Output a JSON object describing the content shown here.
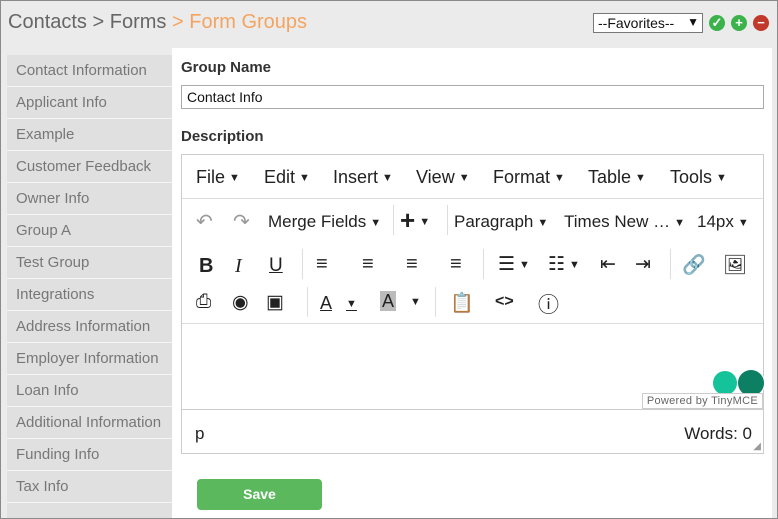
{
  "breadcrumb": {
    "contacts": "Contacts",
    "separator1": ">",
    "forms": "Forms",
    "separator2": ">",
    "current": "Form Groups"
  },
  "favorites": {
    "selected": "--Favorites--"
  },
  "header_icons": [
    "check-icon",
    "plus-icon",
    "minus-icon"
  ],
  "sidebar": {
    "items": [
      {
        "label": "Contact Information"
      },
      {
        "label": "Applicant Info"
      },
      {
        "label": "Example"
      },
      {
        "label": "Customer Feedback"
      },
      {
        "label": "Owner Info"
      },
      {
        "label": "Group A"
      },
      {
        "label": "Test Group"
      },
      {
        "label": "Integrations"
      },
      {
        "label": "Address Information"
      },
      {
        "label": "Employer Information"
      },
      {
        "label": "Loan Info"
      },
      {
        "label": "Additional Information"
      },
      {
        "label": "Funding Info"
      },
      {
        "label": "Tax Info"
      }
    ]
  },
  "form": {
    "group_name_label": "Group Name",
    "group_name_value": "Contact Info",
    "description_label": "Description"
  },
  "editor": {
    "menu": {
      "file": "File",
      "edit": "Edit",
      "insert": "Insert",
      "view": "View",
      "format": "Format",
      "table": "Table",
      "tools": "Tools"
    },
    "toolbar": {
      "merge_fields": "Merge Fields",
      "block_format": "Paragraph",
      "font_family": "Times New …",
      "font_size": "14px"
    },
    "powered_by": "Powered by TinyMCE",
    "status_path": "p",
    "word_count": "Words: 0"
  },
  "save_label": "Save",
  "colors": {
    "breadcrumb_current": "#f4a460",
    "save_button": "#5cb85c",
    "check_icon": "#3cb34a",
    "plus_icon": "#3cb34a",
    "minus_icon": "#c0392b"
  }
}
